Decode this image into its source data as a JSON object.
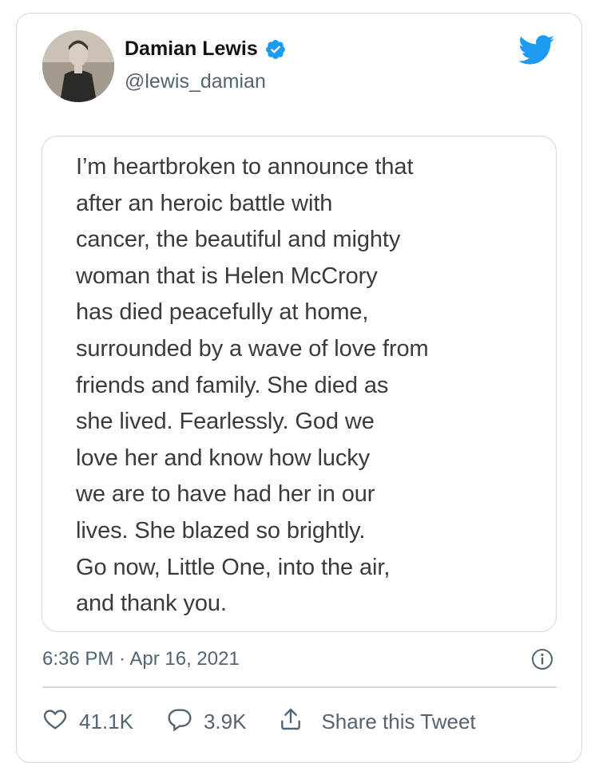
{
  "tweet": {
    "author": {
      "name": "Damian Lewis",
      "handle": "@lewis_damian",
      "verified": true
    },
    "quoted_text": "I’m heartbroken to announce that\nafter an heroic battle with\ncancer, the beautiful and mighty\nwoman that is Helen McCrory\nhas died peacefully at home,\nsurrounded by a wave of love from\nfriends and family. She died as\nshe lived. Fearlessly. God we\nlove her and know how lucky\nwe are to have had her in our\nlives. She blazed so brightly.\nGo now, Little One, into the air,\nand thank you.",
    "timestamp": "6:36 PM · Apr 16, 2021",
    "actions": {
      "likes": "41.1K",
      "replies": "3.9K",
      "share_label": "Share this Tweet"
    }
  },
  "icons": {
    "bird": "twitter-bird-icon",
    "verified": "verified-badge-icon",
    "info": "info-icon",
    "like": "heart-icon",
    "reply": "reply-bubble-icon",
    "share": "share-upload-icon"
  },
  "colors": {
    "brand_blue": "#1d9bf0",
    "text_primary": "#0f1419",
    "text_secondary": "#536471",
    "border": "#cfd9de"
  }
}
